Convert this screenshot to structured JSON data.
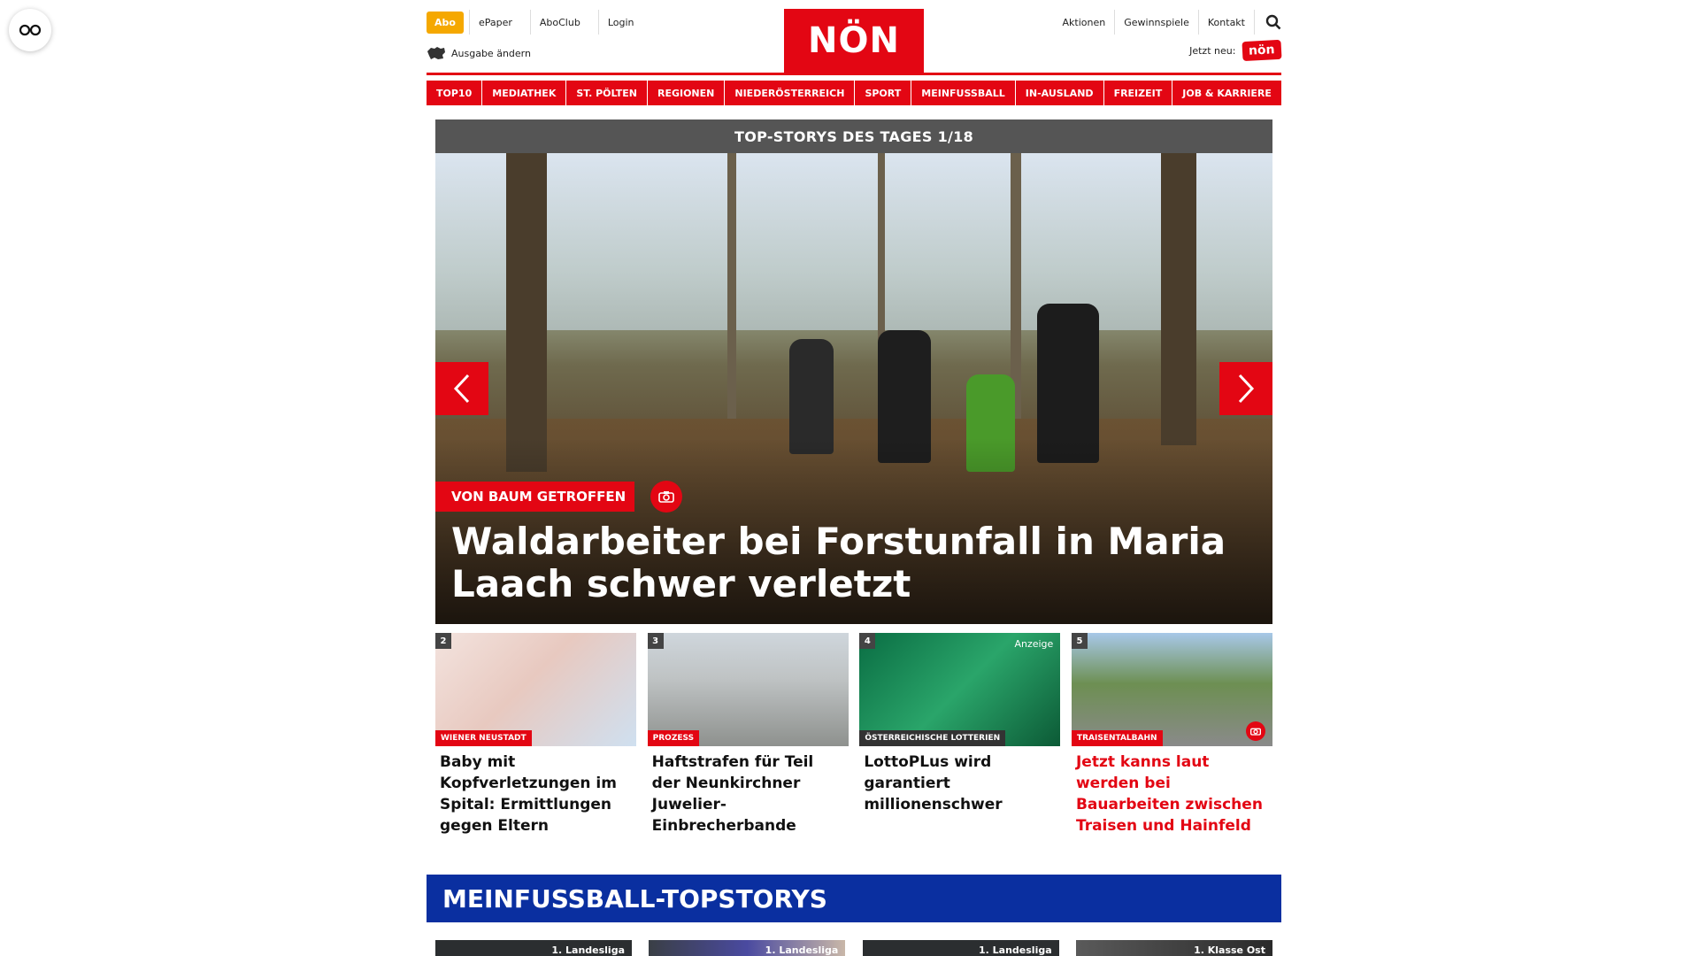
{
  "header": {
    "abo": "Abo",
    "left_links": [
      "ePaper",
      "AboClub",
      "Login"
    ],
    "ausgabe": "Ausgabe ändern",
    "logo": "NÖN",
    "right_links": [
      "Aktionen",
      "Gewinnspiele",
      "Kontakt"
    ],
    "jetzt_neu": "Jetzt neu:",
    "small_logo": "nön"
  },
  "nav": [
    "TOP10",
    "MEDIATHEK",
    "ST. PÖLTEN",
    "REGIONEN",
    "NIEDERÖSTERREICH",
    "SPORT",
    "MEINFUSSBALL",
    "IN-AUSLAND",
    "FREIZEIT",
    "JOB & KARRIERE"
  ],
  "hero": {
    "heading": "TOP-STORYS DES TAGES 1/18",
    "kicker": "VON BAUM GETROFFEN",
    "title": "Waldarbeiter bei Forstunfall in Maria Laach schwer verletzt"
  },
  "stories": [
    {
      "num": "2",
      "tag": "WIENER NEUSTADT",
      "title": "Baby mit Kopfverletzungen im Spital: Ermittlungen gegen Eltern"
    },
    {
      "num": "3",
      "tag": "PROZESS",
      "title": "Haftstrafen für Teil der Neunkirchner Juwelier-Einbrecherbande"
    },
    {
      "num": "4",
      "tag": "ÖSTERREICHISCHE LOTTERIEN",
      "title": "LottoPLus wird garantiert millionenschwer",
      "anzeige": "Anzeige"
    },
    {
      "num": "5",
      "tag": "TRAISENTALBAHN",
      "title": "Jetzt kanns laut werden bei Bauarbeiten zwischen Traisen und Hainfeld"
    }
  ],
  "meinfussball": {
    "heading": "MEINFUSSBALL-TOPSTORYS",
    "cards": [
      "1. Landesliga",
      "1. Landesliga",
      "1. Landesliga",
      "1. Klasse Ost"
    ]
  },
  "colors": {
    "brand_red": "#e30613",
    "abo_orange": "#f5a800",
    "fussball_blue": "#0a2fa0"
  }
}
